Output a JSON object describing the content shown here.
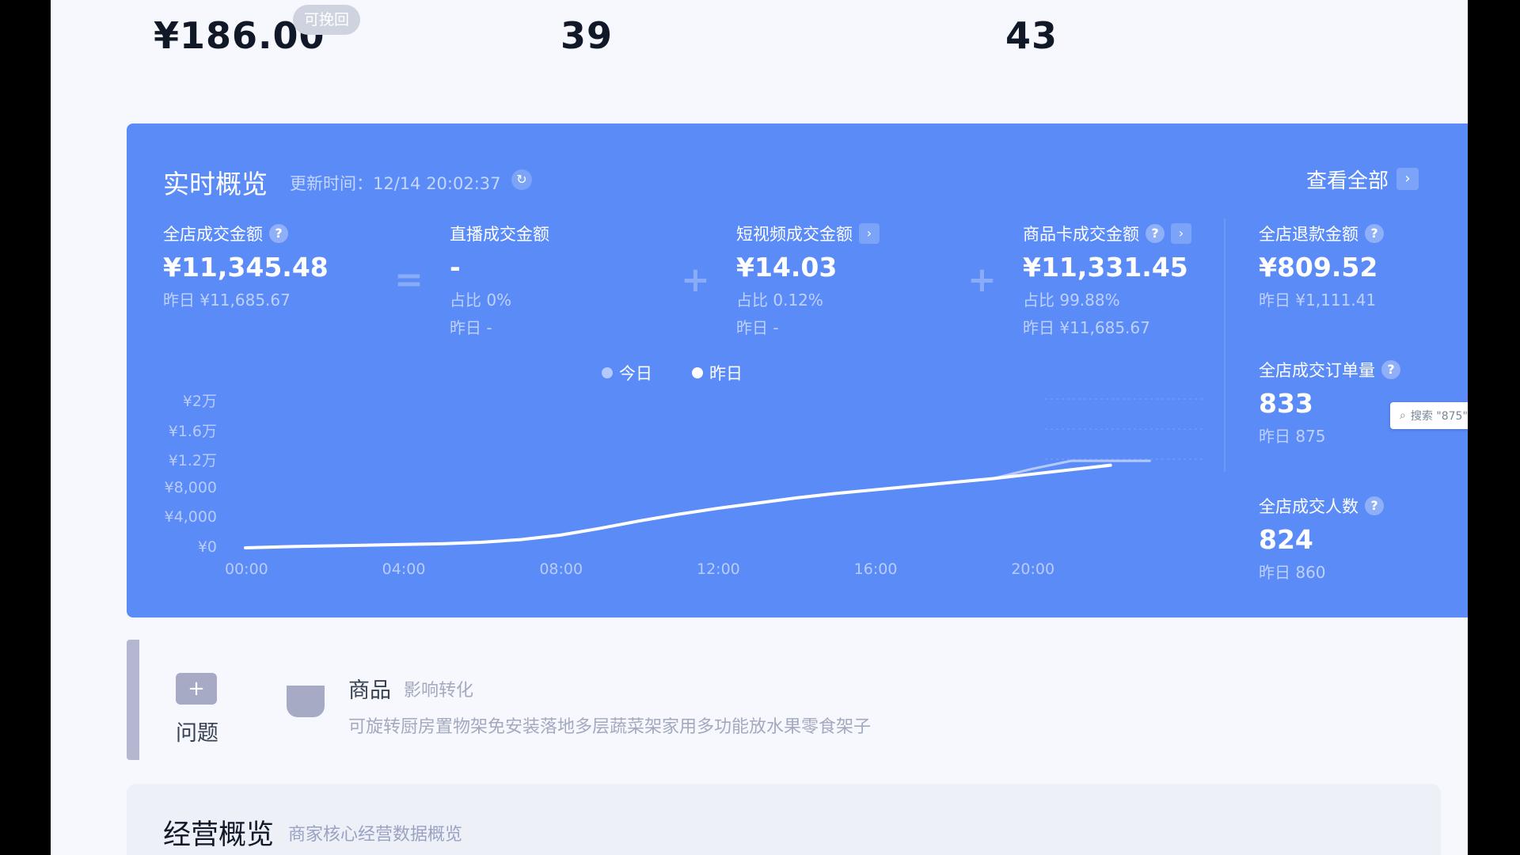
{
  "top_metrics": {
    "amount": "¥186.00",
    "badge": "可挽回",
    "count_a": "39",
    "count_b": "43"
  },
  "realtime": {
    "title": "实时概览",
    "update_time": "更新时间：12/14 20:02:37",
    "view_all": "查看全部",
    "metrics": [
      {
        "label": "全店成交金额",
        "value": "¥11,345.48",
        "sub1": "昨日 ¥11,685.67"
      },
      {
        "label": "直播成交金额",
        "value": "-",
        "sub1": "占比 0%",
        "sub2": "昨日 -"
      },
      {
        "label": "短视频成交金额",
        "value": "¥14.03",
        "sub1": "占比 0.12%",
        "sub2": "昨日 -"
      },
      {
        "label": "商品卡成交金额",
        "value": "¥11,331.45",
        "sub1": "占比 99.88%",
        "sub2": "昨日 ¥11,685.67"
      }
    ],
    "side_metrics": [
      {
        "label": "全店退款金额",
        "value": "¥809.52",
        "sub": "昨日 ¥1,111.41"
      },
      {
        "label": "全店成交订单量",
        "value": "833",
        "sub": "昨日 875"
      },
      {
        "label": "全店成交人数",
        "value": "824",
        "sub": "昨日 860"
      }
    ],
    "operators": [
      "=",
      "+",
      "+"
    ],
    "search_popup": "搜索 \"875\"",
    "legend": {
      "today": "今日",
      "yesterday": "昨日"
    }
  },
  "chart_data": {
    "type": "line",
    "x": [
      "00:00",
      "01:00",
      "02:00",
      "03:00",
      "04:00",
      "05:00",
      "06:00",
      "07:00",
      "08:00",
      "09:00",
      "10:00",
      "11:00",
      "12:00",
      "13:00",
      "14:00",
      "15:00",
      "16:00",
      "17:00",
      "18:00",
      "19:00",
      "20:00",
      "21:00",
      "22:00",
      "23:00"
    ],
    "x_ticks": [
      "00:00",
      "04:00",
      "08:00",
      "12:00",
      "16:00",
      "20:00"
    ],
    "y_ticks": [
      "¥2万",
      "¥1.6万",
      "¥1.2万",
      "¥8,000",
      "¥4,000",
      "¥0"
    ],
    "ylim": [
      0,
      20000
    ],
    "series": [
      {
        "name": "今日",
        "values": [
          0,
          150,
          250,
          350,
          450,
          550,
          750,
          1100,
          1700,
          2600,
          3600,
          4500,
          5300,
          6000,
          6700,
          7300,
          7800,
          8300,
          8800,
          9300,
          9900,
          10500,
          11100
        ]
      },
      {
        "name": "昨日",
        "values": [
          0,
          150,
          250,
          350,
          450,
          550,
          750,
          1100,
          1700,
          2600,
          3600,
          4500,
          5300,
          6000,
          6700,
          7300,
          7800,
          8300,
          8800,
          9300,
          10600,
          11685.67,
          11685.67,
          11685.67
        ]
      }
    ],
    "colors": {
      "today": "#ffffff",
      "yesterday": "#b3c9ff"
    },
    "grid": false
  },
  "issues": {
    "label": "问题",
    "goods_title": "商品",
    "goods_tag": "影响转化",
    "goods_desc": "可旋转厨房置物架免安装落地多层蔬菜架家用多功能放水果零食架子"
  },
  "business": {
    "title": "经营概览",
    "subtitle": "商家核心经营数据概览"
  }
}
